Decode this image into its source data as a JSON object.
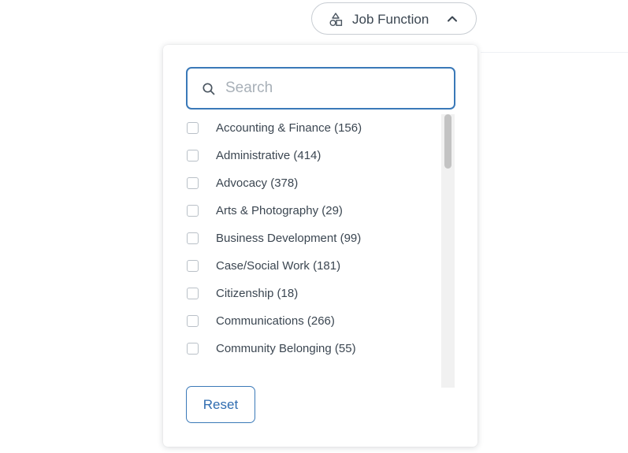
{
  "filter_pill": {
    "label": "Job Function",
    "icon": "shapes-icon",
    "chevron": "chevron-up-icon"
  },
  "dropdown": {
    "search": {
      "placeholder": "Search",
      "value": "",
      "icon": "search-icon"
    },
    "options": [
      {
        "label": "Accounting & Finance (156)",
        "checked": false
      },
      {
        "label": "Administrative (414)",
        "checked": false
      },
      {
        "label": "Advocacy (378)",
        "checked": false
      },
      {
        "label": "Arts & Photography (29)",
        "checked": false
      },
      {
        "label": "Business Development (99)",
        "checked": false
      },
      {
        "label": "Case/Social Work (181)",
        "checked": false
      },
      {
        "label": "Citizenship (18)",
        "checked": false
      },
      {
        "label": "Communications (266)",
        "checked": false
      },
      {
        "label": "Community Belonging (55)",
        "checked": false
      }
    ],
    "reset_label": "Reset"
  },
  "colors": {
    "accent": "#3a79b8",
    "accent_text": "#2f6cb0",
    "text": "#3b4651",
    "placeholder": "#a8b0b8",
    "border": "#c8cdd3"
  }
}
